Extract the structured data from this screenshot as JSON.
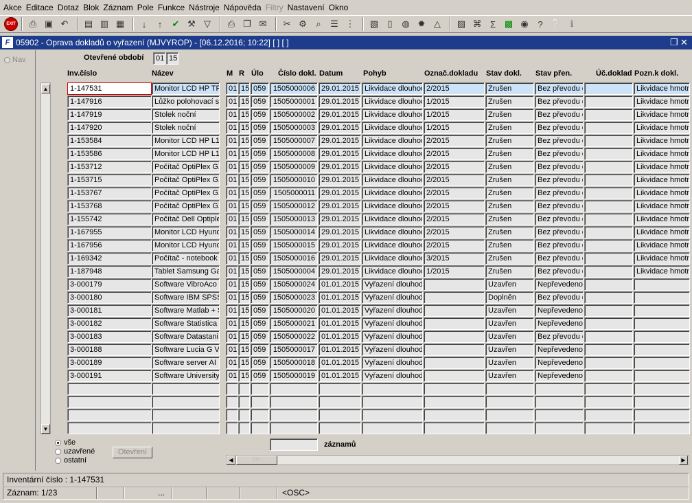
{
  "menu": [
    "Akce",
    "Editace",
    "Dotaz",
    "Blok",
    "Záznam",
    "Pole",
    "Funkce",
    "Nástroje",
    "Nápověda",
    "Filtry",
    "Nastavení",
    "Okno"
  ],
  "menu_disabled": [
    "Filtry"
  ],
  "window": {
    "title": "05902 - Oprava dokladů o vyřazení (MJVYROP) - [06.12.2016; 10:22] [ ] [ ]"
  },
  "nav_label": "Nav",
  "period": {
    "label": "Otevřené období",
    "month": "01",
    "year": "15"
  },
  "columns": [
    "Inv.číslo",
    "Název",
    "M",
    "R",
    "Úlo",
    "Číslo dokl.",
    "Datum",
    "Pohyb",
    "Označ.dokladu",
    "Stav dokl.",
    "Stav přen.",
    "Úč.doklad",
    "Pozn.k dokl."
  ],
  "rows": [
    [
      "1-147531",
      "Monitor LCD HP TFT",
      "01",
      "15",
      "059",
      "1505000006",
      "29.01.2015",
      "Likvidace dlouhod",
      "2/2015",
      "Zrušen",
      "Bez převodu do",
      "",
      "Likvidace hmotn"
    ],
    [
      "1-147916",
      "Lůžko polohovací s",
      "01",
      "15",
      "059",
      "1505000001",
      "29.01.2015",
      "Likvidace dlouhod",
      "1/2015",
      "Zrušen",
      "Bez převodu do",
      "",
      "Likvidace hmotn"
    ],
    [
      "1-147919",
      "Stolek noční",
      "01",
      "15",
      "059",
      "1505000002",
      "29.01.2015",
      "Likvidace dlouhod",
      "1/2015",
      "Zrušen",
      "Bez převodu do",
      "",
      "Likvidace hmotn"
    ],
    [
      "1-147920",
      "Stolek noční",
      "01",
      "15",
      "059",
      "1505000003",
      "29.01.2015",
      "Likvidace dlouhod",
      "1/2015",
      "Zrušen",
      "Bez převodu do",
      "",
      "Likvidace hmotn"
    ],
    [
      "1-153584",
      "Monitor LCD HP L19",
      "01",
      "15",
      "059",
      "1505000007",
      "29.01.2015",
      "Likvidace dlouhod",
      "2/2015",
      "Zrušen",
      "Bez převodu do",
      "",
      "Likvidace hmotn"
    ],
    [
      "1-153586",
      "Monitor LCD HP L19",
      "01",
      "15",
      "059",
      "1505000008",
      "29.01.2015",
      "Likvidace dlouhod",
      "2/2015",
      "Zrušen",
      "Bez převodu do",
      "",
      "Likvidace hmotn"
    ],
    [
      "1-153712",
      "Počítač OptiPlex GX",
      "01",
      "15",
      "059",
      "1505000009",
      "29.01.2015",
      "Likvidace dlouhod",
      "2/2015",
      "Zrušen",
      "Bez převodu do",
      "",
      "Likvidace hmotn"
    ],
    [
      "1-153715",
      "Počítač OptiPlex GX",
      "01",
      "15",
      "059",
      "1505000010",
      "29.01.2015",
      "Likvidace dlouhod",
      "2/2015",
      "Zrušen",
      "Bez převodu do",
      "",
      "Likvidace hmotn"
    ],
    [
      "1-153767",
      "Počítač OptiPlex GX",
      "01",
      "15",
      "059",
      "1505000011",
      "29.01.2015",
      "Likvidace dlouhod",
      "2/2015",
      "Zrušen",
      "Bez převodu do",
      "",
      "Likvidace hmotn"
    ],
    [
      "1-153768",
      "Počítač OptiPlex GX",
      "01",
      "15",
      "059",
      "1505000012",
      "29.01.2015",
      "Likvidace dlouhod",
      "2/2015",
      "Zrušen",
      "Bez převodu do",
      "",
      "Likvidace hmotn"
    ],
    [
      "1-155742",
      "Počítač Dell Optiplex",
      "01",
      "15",
      "059",
      "1505000013",
      "29.01.2015",
      "Likvidace dlouhod",
      "2/2015",
      "Zrušen",
      "Bez převodu do",
      "",
      "Likvidace hmotn"
    ],
    [
      "1-167955",
      "Monitor LCD Hyunda",
      "01",
      "15",
      "059",
      "1505000014",
      "29.01.2015",
      "Likvidace dlouhod",
      "2/2015",
      "Zrušen",
      "Bez převodu do",
      "",
      "Likvidace hmotn"
    ],
    [
      "1-167956",
      "Monitor LCD Hyunda",
      "01",
      "15",
      "059",
      "1505000015",
      "29.01.2015",
      "Likvidace dlouhod",
      "2/2015",
      "Zrušen",
      "Bez převodu do",
      "",
      "Likvidace hmotn"
    ],
    [
      "1-169342",
      "Počítač - notebook H",
      "01",
      "15",
      "059",
      "1505000016",
      "29.01.2015",
      "Likvidace dlouhod",
      "3/2015",
      "Zrušen",
      "Bez převodu do",
      "",
      "Likvidace hmotn"
    ],
    [
      "1-187948",
      "Tablet Samsung Ga",
      "01",
      "15",
      "059",
      "1505000004",
      "29.01.2015",
      "Likvidace dlouhod",
      "1/2015",
      "Zrušen",
      "Bez převodu do",
      "",
      "Likvidace hmotn"
    ],
    [
      "3-000179",
      "Software VibroAco",
      "01",
      "15",
      "059",
      "1505000024",
      "01.01.2015",
      "Vyřazení dlouhod",
      "",
      "Uzavřen",
      "Nepřevedeno",
      "",
      ""
    ],
    [
      "3-000180",
      "Software IBM SPSS",
      "01",
      "15",
      "059",
      "1505000023",
      "01.01.2015",
      "Vyřazení dlouhod",
      "",
      "Doplněn",
      "Bez převodu do",
      "",
      ""
    ],
    [
      "3-000181",
      "Software Matlab + S",
      "01",
      "15",
      "059",
      "1505000020",
      "01.01.2015",
      "Vyřazení dlouhod",
      "",
      "Uzavřen",
      "Nepřevedeno",
      "",
      ""
    ],
    [
      "3-000182",
      "Software Statistica",
      "01",
      "15",
      "059",
      "1505000021",
      "01.01.2015",
      "Vyřazení dlouhod",
      "",
      "Uzavřen",
      "Nepřevedeno",
      "",
      ""
    ],
    [
      "3-000183",
      "Software Datastani",
      "01",
      "15",
      "059",
      "1505000022",
      "01.01.2015",
      "Vyřazení dlouhod",
      "",
      "Uzavřen",
      "Bez převodu do",
      "",
      ""
    ],
    [
      "3-000188",
      "Software Lucia G V",
      "01",
      "15",
      "059",
      "1505000017",
      "01.01.2015",
      "Vyřazení dlouhod",
      "",
      "Uzavřen",
      "Nepřevedeno",
      "",
      ""
    ],
    [
      "3-000189",
      "Software server AI",
      "01",
      "15",
      "059",
      "1505000018",
      "01.01.2015",
      "Vyřazení dlouhod",
      "",
      "Uzavřen",
      "Nepřevedeno",
      "",
      ""
    ],
    [
      "3-000191",
      "Software University",
      "01",
      "15",
      "059",
      "1505000019",
      "01.01.2015",
      "Vyřazení dlouhod",
      "",
      "Uzavřen",
      "Nepřevedeno",
      "",
      ""
    ],
    [
      "",
      "",
      "",
      "",
      "",
      "",
      "",
      "",
      "",
      "",
      "",
      "",
      ""
    ],
    [
      "",
      "",
      "",
      "",
      "",
      "",
      "",
      "",
      "",
      "",
      "",
      "",
      ""
    ],
    [
      "",
      "",
      "",
      "",
      "",
      "",
      "",
      "",
      "",
      "",
      "",
      "",
      ""
    ],
    [
      "",
      "",
      "",
      "",
      "",
      "",
      "",
      "",
      "",
      "",
      "",
      "",
      ""
    ]
  ],
  "filter": {
    "options": [
      "vše",
      "uzavřené",
      "ostatní"
    ],
    "selected": "vše",
    "button": "Otevření"
  },
  "records_label": "záznamů",
  "records_value": "",
  "status": {
    "line1": "Inventární číslo : 1-147531",
    "record": "Záznam: 1/23",
    "ellipsis": "...",
    "osc": "<OSC>"
  }
}
